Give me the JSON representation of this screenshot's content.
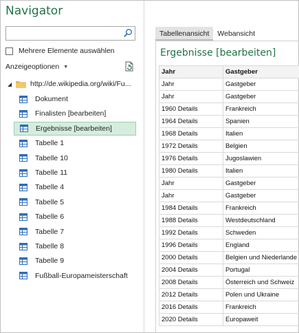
{
  "window": {
    "title": "Navigator"
  },
  "search": {
    "placeholder": "",
    "value": ""
  },
  "options": {
    "multi_select_label": "Mehrere Elemente auswählen",
    "display_options_label": "Anzeigeoptionen"
  },
  "tree": {
    "root_label": "http://de.wikipedia.org/wiki/Fu...",
    "items": [
      {
        "label": "Dokument",
        "selected": false
      },
      {
        "label": "Finalisten [bearbeiten]",
        "selected": false
      },
      {
        "label": "Ergebnisse [bearbeiten]",
        "selected": true
      },
      {
        "label": "Tabelle 1",
        "selected": false
      },
      {
        "label": "Tabelle 10",
        "selected": false
      },
      {
        "label": "Tabelle 11",
        "selected": false
      },
      {
        "label": "Tabelle 4",
        "selected": false
      },
      {
        "label": "Tabelle 5",
        "selected": false
      },
      {
        "label": "Tabelle 6",
        "selected": false
      },
      {
        "label": "Tabelle 7",
        "selected": false
      },
      {
        "label": "Tabelle 8",
        "selected": false
      },
      {
        "label": "Tabelle 9",
        "selected": false
      },
      {
        "label": "Fußball-Europameisterschaft",
        "selected": false
      }
    ]
  },
  "tabs": [
    {
      "label": "Tabellenansicht",
      "active": true
    },
    {
      "label": "Webansicht",
      "active": false
    }
  ],
  "preview": {
    "title": "Ergebnisse [bearbeiten]",
    "columns": [
      "Jahr",
      "Gastgeber"
    ],
    "rows": [
      [
        "Jahr",
        "Gastgeber"
      ],
      [
        "Jahr",
        "Gastgeber"
      ],
      [
        "1960 Details",
        "Frankreich"
      ],
      [
        "1964 Details",
        "Spanien"
      ],
      [
        "1968 Details",
        "Italien"
      ],
      [
        "1972 Details",
        "Belgien"
      ],
      [
        "1976 Details",
        "Jugoslawien"
      ],
      [
        "1980 Details",
        "Italien"
      ],
      [
        "Jahr",
        "Gastgeber"
      ],
      [
        "Jahr",
        "Gastgeber"
      ],
      [
        "1984 Details",
        "Frankreich"
      ],
      [
        "1988 Details",
        "Westdeutschland"
      ],
      [
        "1992 Details",
        "Schweden"
      ],
      [
        "1996 Details",
        "England"
      ],
      [
        "2000 Details",
        "Belgien und Niederlande"
      ],
      [
        "2004 Details",
        "Portugal"
      ],
      [
        "2008 Details",
        "Österreich und Schweiz"
      ],
      [
        "2012 Details",
        "Polen und Ukraine"
      ],
      [
        "2016 Details",
        "Frankreich"
      ],
      [
        "2020 Details",
        "Europaweit"
      ]
    ]
  },
  "colors": {
    "accent": "#217346",
    "selected_bg": "#d6ecdf",
    "icon_blue": "#2f6db5",
    "folder": "#e8b54a"
  }
}
